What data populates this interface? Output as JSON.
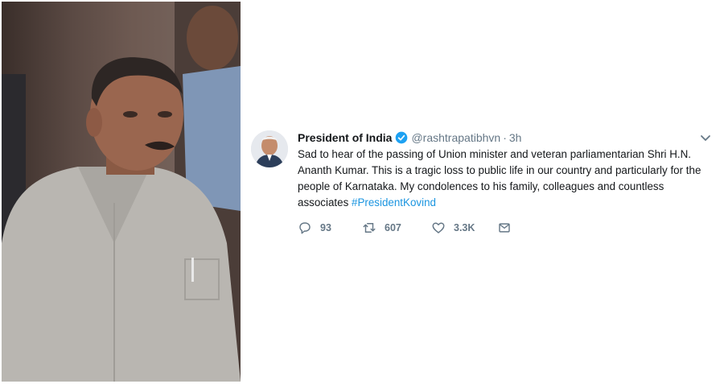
{
  "tweet": {
    "display_name": "President of India",
    "handle": "@rashtrapatibhvn",
    "separator": "·",
    "time": "3h",
    "text": "Sad to hear of the passing of Union minister and veteran parliamentarian Shri H.N. Ananth Kumar. This is a tragic loss to public life in our country and particularly for the people of Karnataka. My condolences to his family, colleagues and countless associates ",
    "hashtag": "#PresidentKovind",
    "replies": "93",
    "retweets": "607",
    "likes": "3.3K"
  },
  "colors": {
    "link": "#1b95e0",
    "secondary_text": "#657786",
    "primary_text": "#14171a"
  },
  "icons": [
    "verified-badge-icon",
    "chevron-down-icon",
    "reply-icon",
    "retweet-icon",
    "like-icon",
    "direct-message-icon"
  ]
}
